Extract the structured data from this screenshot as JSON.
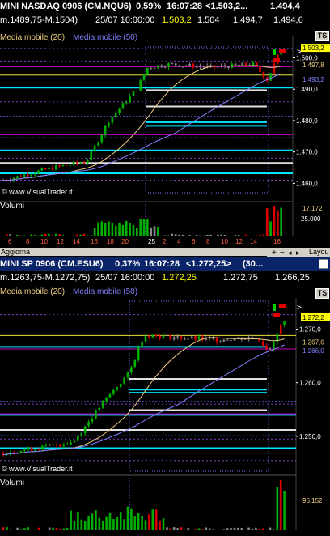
{
  "colors": {
    "up": "#00b000",
    "down": "#e00000",
    "neutral": "#888888",
    "ma20": "#f0d080",
    "ma50": "#8080ff",
    "cyan": "#00e5ff",
    "magenta": "#c000c0"
  },
  "top": {
    "title": {
      "instrument": "MINI NASDAQ 0906 (CM.NQU6)",
      "change": "0,59%",
      "time": "16:07:28",
      "price": "<1.503,2...",
      "last": "1.494,4",
      "pct2": "0,59"
    },
    "sub": {
      "range": "m.1489,75-M.1504)",
      "datetime": "25/07 16:00:00",
      "last": "1.503,2",
      "v1": "1.504",
      "v2": "1.494,7",
      "v3": "1.494,6"
    },
    "legend_ma20": "Media mobile (20)",
    "legend_ma50": "Media mobile (50)",
    "price_labels": [
      "1.500,0",
      "1.490,0",
      "1.480,0",
      "1.470,0",
      "1.460,0"
    ],
    "tags": [
      "1.503,2",
      "1.497,8",
      "1.493,2"
    ],
    "watermark": "© www.VisualTrader.it",
    "volume_label": "Volumi",
    "vol_labels": [
      "25.000",
      "17.172"
    ],
    "x_labels": [
      "6",
      "8",
      "10",
      "12",
      "14",
      "16",
      "18",
      "20",
      "25",
      "2",
      "4",
      "6",
      "8",
      "10",
      "12",
      "14",
      "16"
    ],
    "scroll_left": "Aggiorna",
    "layout": "Layou",
    "ts": "TS"
  },
  "bottom": {
    "title": {
      "instrument": "MINI SP 0906 (CM.ESU6)",
      "change": "0,37%",
      "time": "16:07:28",
      "price": "<1.272,25>",
      "extra": "(30..."
    },
    "sub": {
      "range": "m.1263,75-M.1272,75)",
      "datetime": "25/07 16:00:00",
      "last": "1.272,25",
      "v1": "1.272,75",
      "v2": "1.266,25"
    },
    "legend_ma20": "Media mobile (20)",
    "legend_ma50": "Media mobile (50)",
    "price_labels": [
      "1.270,0",
      "1.260,0",
      "1.250,0"
    ],
    "tags": [
      "1.272,2",
      "1.267,6",
      "1.266,0"
    ],
    "watermark": "© www.VisualTrader.it",
    "volume_label": "Volumi",
    "vol_labels": [
      "96.152"
    ],
    "ts": "TS"
  },
  "chart_data": [
    {
      "type": "candlestick",
      "title": "MINI NASDAQ 0906 (CM.NQU6)",
      "ylim": [
        1455,
        1508
      ],
      "series": [
        {
          "name": "Media mobile (20)"
        },
        {
          "name": "Media mobile (50)"
        }
      ],
      "yticks": [
        "1.500,0",
        "1.490,0",
        "1.480,0",
        "1.470,0",
        "1.460,0"
      ]
    },
    {
      "type": "candlestick",
      "title": "MINI SP 0906 (CM.ESU6)",
      "ylim": [
        1244,
        1276
      ],
      "series": [
        {
          "name": "Media mobile (20)"
        },
        {
          "name": "Media mobile (50)"
        }
      ],
      "yticks": [
        "1.270,0",
        "1.260,0",
        "1.250,0"
      ]
    }
  ]
}
